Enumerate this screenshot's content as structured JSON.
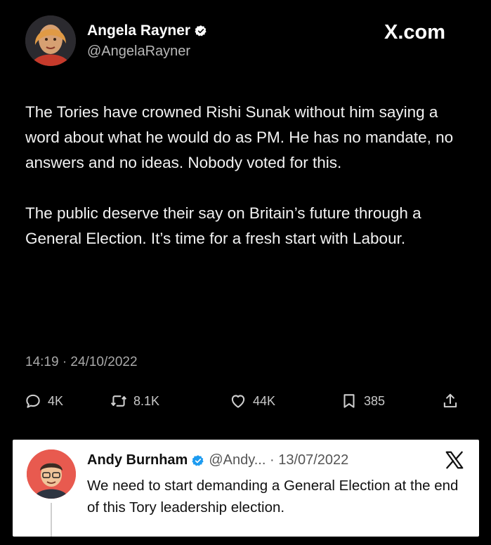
{
  "tweet": {
    "author_name": "Angela Rayner",
    "author_handle": "@AngelaRayner",
    "site_label": "X.com",
    "paragraphs": [
      "The Tories have crowned Rishi Sunak without him saying a word about what he would do as PM. He has no mandate, no answers and no ideas. Nobody voted for this.",
      "The public deserve their say on Britain’s future through a General Election. It’s time for a fresh start with Labour."
    ],
    "timestamp": "14:19 · 24/10/2022",
    "actions": {
      "replies": "4K",
      "reposts": "8.1K",
      "likes": "44K",
      "bookmarks": "385"
    }
  },
  "quoted": {
    "author_name": "Andy Burnham",
    "meta": "@Andy... · 13/07/2022",
    "text": "We need to start demanding a General Election at the end of this Tory leadership election."
  },
  "icons": {
    "verified": "verified-badge-icon",
    "reply": "reply-icon",
    "repost": "repost-icon",
    "like": "heart-icon",
    "bookmark": "bookmark-icon",
    "share": "share-icon",
    "x_logo": "x-logo-icon"
  },
  "colors": {
    "background": "#000000",
    "verified_badge": "#ffffff",
    "quoted_badge": "#1d9bf0",
    "quote_card": "#ffffff"
  }
}
